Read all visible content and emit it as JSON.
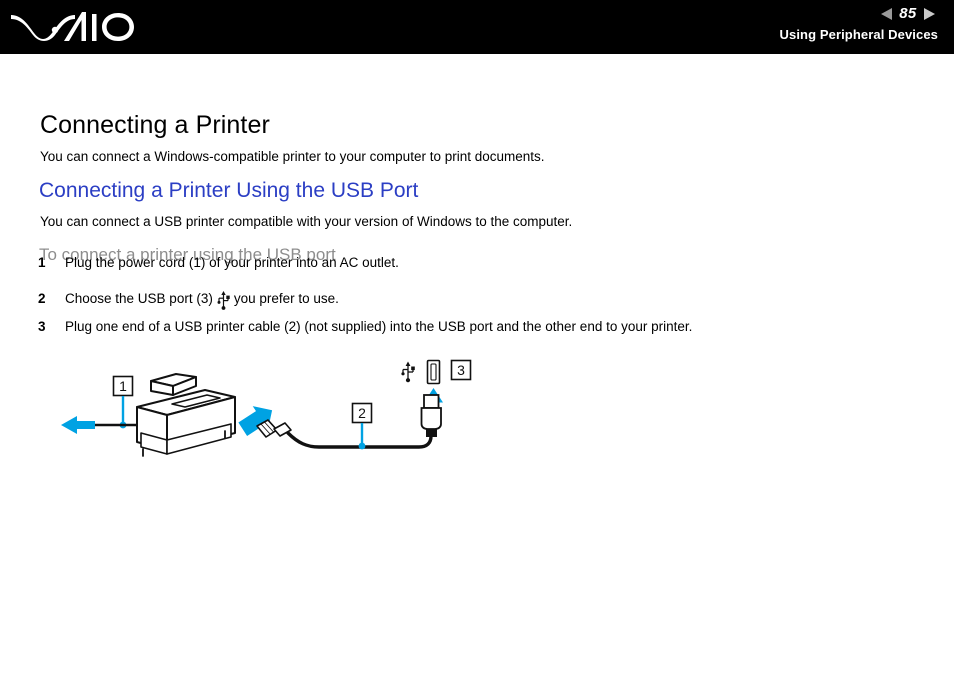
{
  "header": {
    "logo_alt": "VAIO",
    "page_number": "85",
    "prev_icon": "left-triangle-icon",
    "next_icon": "right-triangle-icon",
    "section_title": "Using Peripheral Devices"
  },
  "main": {
    "heading": "Connecting a Printer",
    "intro": "You can connect a Windows-compatible printer to your computer to print documents.",
    "subheading": "Connecting a Printer Using the USB Port",
    "subintro": "You can connect a USB printer compatible with your version of Windows to the computer.",
    "procedure_title": "To connect a printer using the USB port",
    "steps": [
      {
        "number": "1",
        "text": "Plug the power cord (1) of your printer into an AC outlet."
      },
      {
        "number": "2",
        "text_before": "Choose the USB port (3)",
        "inline_icon": "usb-trident-icon",
        "text_after": "you prefer to use."
      },
      {
        "number": "3",
        "text": "Plug one end of a USB printer cable (2) (not supplied) into the USB port and the other end to your printer."
      }
    ]
  },
  "figure": {
    "alt": "Diagram showing a printer connected by a USB cable to a computer USB port",
    "callouts": [
      {
        "label": "1",
        "meaning": "power-cord"
      },
      {
        "label": "2",
        "meaning": "usb-printer-cable"
      },
      {
        "label": "3",
        "meaning": "usb-port"
      }
    ],
    "icons": [
      "usb-trident-icon",
      "usb-port-slot-icon"
    ]
  },
  "colors": {
    "accent_blue": "#00a2e3",
    "heading_blue": "#2b3ec4",
    "procedure_grey": "#8d8d8d",
    "header_bg": "#000000",
    "page_bg": "#ffffff",
    "line_art": "#1a1a1a"
  }
}
